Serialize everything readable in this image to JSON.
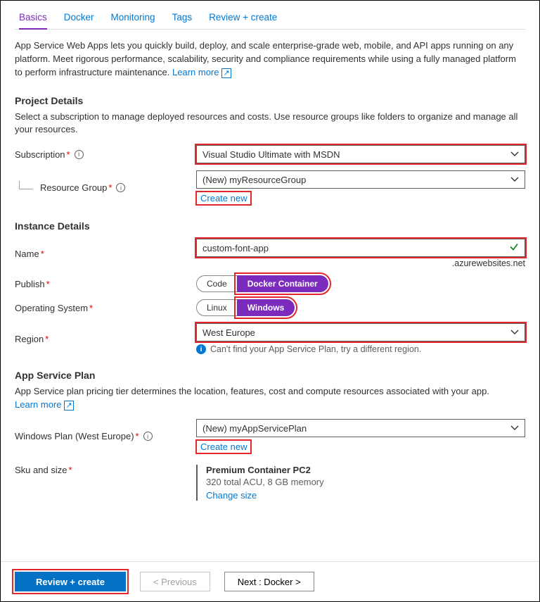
{
  "tabs": {
    "basics": "Basics",
    "docker": "Docker",
    "monitoring": "Monitoring",
    "tags": "Tags",
    "review": "Review + create"
  },
  "intro": "App Service Web Apps lets you quickly build, deploy, and scale enterprise-grade web, mobile, and API apps running on any platform. Meet rigorous performance, scalability, security and compliance requirements while using a fully managed platform to perform infrastructure maintenance.   ",
  "learn_more": "Learn more",
  "project": {
    "heading": "Project Details",
    "desc": "Select a subscription to manage deployed resources and costs. Use resource groups like folders to organize and manage all your resources.",
    "subscription_label": "Subscription",
    "subscription_value": "Visual Studio Ultimate with MSDN",
    "rg_label": "Resource Group",
    "rg_value": "(New) myResourceGroup",
    "create_new": "Create new"
  },
  "instance": {
    "heading": "Instance Details",
    "name_label": "Name",
    "name_value": "custom-font-app",
    "name_suffix": ".azurewebsites.net",
    "publish_label": "Publish",
    "publish_code": "Code",
    "publish_docker": "Docker Container",
    "os_label": "Operating System",
    "os_linux": "Linux",
    "os_windows": "Windows",
    "region_label": "Region",
    "region_value": "West Europe",
    "region_help": "Can't find your App Service Plan, try a different region."
  },
  "plan": {
    "heading": "App Service Plan",
    "desc": "App Service plan pricing tier determines the location, features, cost and compute resources associated with your app. ",
    "learn_more": "Learn more",
    "win_plan_label": "Windows Plan (West Europe)",
    "win_plan_value": "(New) myAppServicePlan",
    "create_new": "Create new",
    "sku_label": "Sku and size",
    "sku_title": "Premium Container PC2",
    "sku_sub": "320 total ACU, 8 GB memory",
    "change_size": "Change size"
  },
  "footer": {
    "review": "Review + create",
    "previous": "< Previous",
    "next": "Next : Docker >"
  }
}
